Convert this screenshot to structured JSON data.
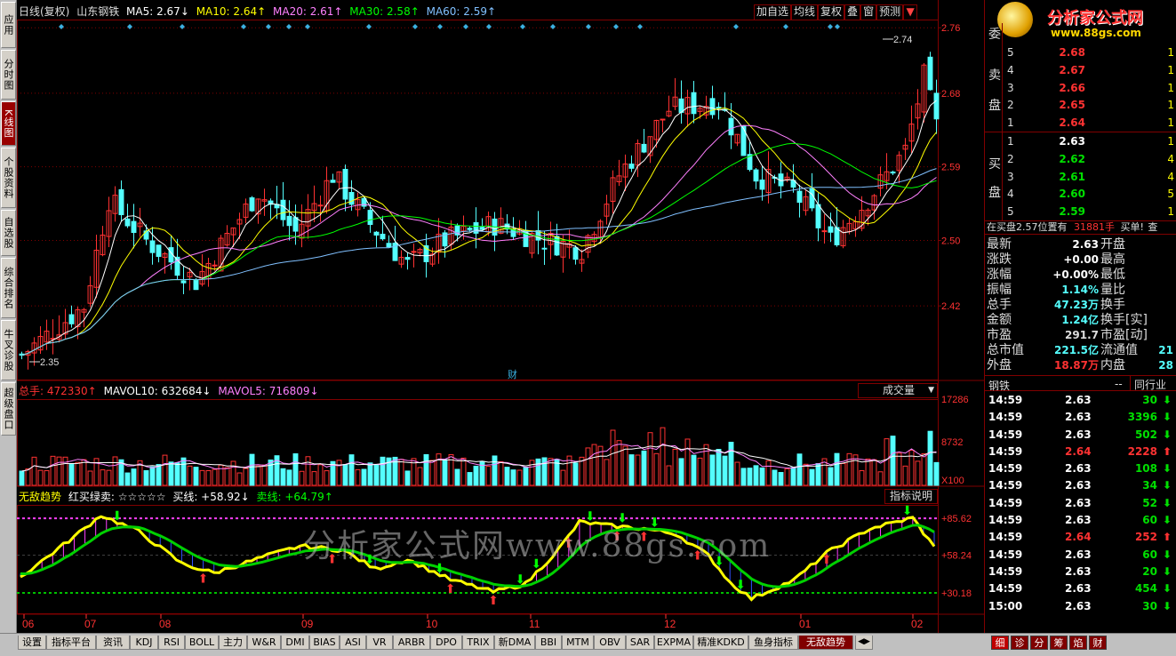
{
  "colors": {
    "up": "#ff3232",
    "down": "#54ffff",
    "ma5": "#ffffff",
    "ma10": "#ffff00",
    "ma20": "#ff80ff",
    "ma30": "#00ff00",
    "ma60": "#80c0ff",
    "grid": "#800000",
    "zx": "#dddd00"
  },
  "left_tabs": [
    "应用",
    "分时图",
    "K线图",
    "个股资料",
    "自选股",
    "综合排名",
    "牛叉诊股",
    "超级盘口"
  ],
  "header": {
    "period": "日线(复权)",
    "stock": "山东钢铁",
    "ma5": "MA5: 2.67↓",
    "ma10": "MA10: 2.64↑",
    "ma20": "MA20: 2.61↑",
    "ma30": "MA30: 2.58↑",
    "ma60": "MA60: 2.59↑"
  },
  "toolbar": [
    "加自选",
    "均线",
    "复权",
    "叠",
    "窗",
    "预测"
  ],
  "main_axis": [
    "2.76",
    "2.68",
    "2.59",
    "2.50",
    "2.42"
  ],
  "high_label": "2.74",
  "low_label": "2.35",
  "cai": "财",
  "vol_header": {
    "a": "总手: 472330↑",
    "b": "MAVOL10: 632684↓",
    "c": "MAVOL5: 716809↓"
  },
  "vol_select": "成交量",
  "vol_axis": [
    "17286",
    "8732",
    "X100"
  ],
  "ind_header": {
    "a": "无敌趋势",
    "b": "红买绿卖: ☆☆☆☆☆",
    "c": "买线: +58.92↓",
    "d": "卖线: +64.79↑"
  },
  "ind_button": "指标说明",
  "ind_axis": [
    "+85.62",
    "+58.24",
    "+30.18"
  ],
  "x_labels": [
    "06",
    "07",
    "08",
    "09",
    "10",
    "11",
    "12",
    "01",
    "02"
  ],
  "watermark": "分析家公式网www.88gs.com",
  "logo": {
    "title": "分析家公式网",
    "url": "www.88gs.com"
  },
  "order_book": {
    "sell_label": [
      "委",
      "卖",
      "盘"
    ],
    "buy_label": [
      "买",
      "盘"
    ],
    "asks": [
      {
        "lv": "5",
        "p": "2.68",
        "v": "1"
      },
      {
        "lv": "4",
        "p": "2.67",
        "v": "1"
      },
      {
        "lv": "3",
        "p": "2.66",
        "v": "1"
      },
      {
        "lv": "2",
        "p": "2.65",
        "v": "1"
      },
      {
        "lv": "1",
        "p": "2.64",
        "v": "1"
      }
    ],
    "bids": [
      {
        "lv": "1",
        "p": "2.63",
        "v": "1"
      },
      {
        "lv": "2",
        "p": "2.62",
        "v": "4"
      },
      {
        "lv": "3",
        "p": "2.61",
        "v": "4"
      },
      {
        "lv": "4",
        "p": "2.60",
        "v": "5"
      },
      {
        "lv": "5",
        "p": "2.59",
        "v": "1"
      }
    ]
  },
  "buy_info": {
    "a": "在买盘2.57位置有",
    "b": "31881手",
    "c": "买单!",
    "d": "查"
  },
  "quote": [
    {
      "k": "最新",
      "v": "2.63",
      "k2": "开盘",
      "c": "#fff"
    },
    {
      "k": "涨跌",
      "v": "+0.00",
      "k2": "最高",
      "c": "#fff"
    },
    {
      "k": "涨幅",
      "v": "+0.00%",
      "k2": "最低",
      "c": "#fff"
    },
    {
      "k": "振幅",
      "v": "1.14%",
      "k2": "量比",
      "c": "#54ffff"
    },
    {
      "k": "总手",
      "v": "47.23万",
      "k2": "换手",
      "c": "#54ffff"
    },
    {
      "k": "金额",
      "v": "1.24亿",
      "k2": "换手[实]",
      "c": "#54ffff"
    },
    {
      "k": "市盈",
      "v": "291.7",
      "k2": "市盈[动]",
      "c": "#ddd"
    },
    {
      "k": "总市值",
      "v": "221.5亿",
      "k2": "流通值",
      "c": "#54ffff",
      "v2": "21"
    },
    {
      "k": "外盘",
      "v": "18.87万",
      "k2": "内盘",
      "c": "#ff3232",
      "v2": "28"
    }
  ],
  "sector": {
    "name": "钢铁",
    "dash": "--",
    "peer": "同行业"
  },
  "ticks": [
    {
      "t": "14:59",
      "p": "2.63",
      "v": "30",
      "d": "down"
    },
    {
      "t": "14:59",
      "p": "2.63",
      "v": "3396",
      "d": "down"
    },
    {
      "t": "14:59",
      "p": "2.63",
      "v": "502",
      "d": "down"
    },
    {
      "t": "14:59",
      "p": "2.64",
      "v": "2228",
      "d": "up"
    },
    {
      "t": "14:59",
      "p": "2.63",
      "v": "108",
      "d": "down"
    },
    {
      "t": "14:59",
      "p": "2.63",
      "v": "34",
      "d": "down"
    },
    {
      "t": "14:59",
      "p": "2.63",
      "v": "52",
      "d": "down"
    },
    {
      "t": "14:59",
      "p": "2.63",
      "v": "60",
      "d": "down"
    },
    {
      "t": "14:59",
      "p": "2.64",
      "v": "252",
      "d": "up"
    },
    {
      "t": "14:59",
      "p": "2.63",
      "v": "60",
      "d": "down"
    },
    {
      "t": "14:59",
      "p": "2.63",
      "v": "20",
      "d": "down"
    },
    {
      "t": "14:59",
      "p": "2.63",
      "v": "454",
      "d": "down"
    },
    {
      "t": "15:00",
      "p": "2.63",
      "v": "30",
      "d": "down"
    }
  ],
  "bottom_tabs": [
    "设置",
    "指标平台",
    "资讯",
    "KDJ",
    "RSI",
    "BOLL",
    "主力",
    "W&R",
    "DMI",
    "BIAS",
    "ASI",
    "VR",
    "ARBR",
    "DPO",
    "TRIX",
    "新DMA",
    "BBI",
    "MTM",
    "OBV",
    "SAR",
    "EXPMA",
    "精准KDKD",
    "鱼身指标",
    "无敌趋势"
  ],
  "right_tabs": [
    "细",
    "诊",
    "分",
    "筹",
    "焰",
    "财"
  ]
}
